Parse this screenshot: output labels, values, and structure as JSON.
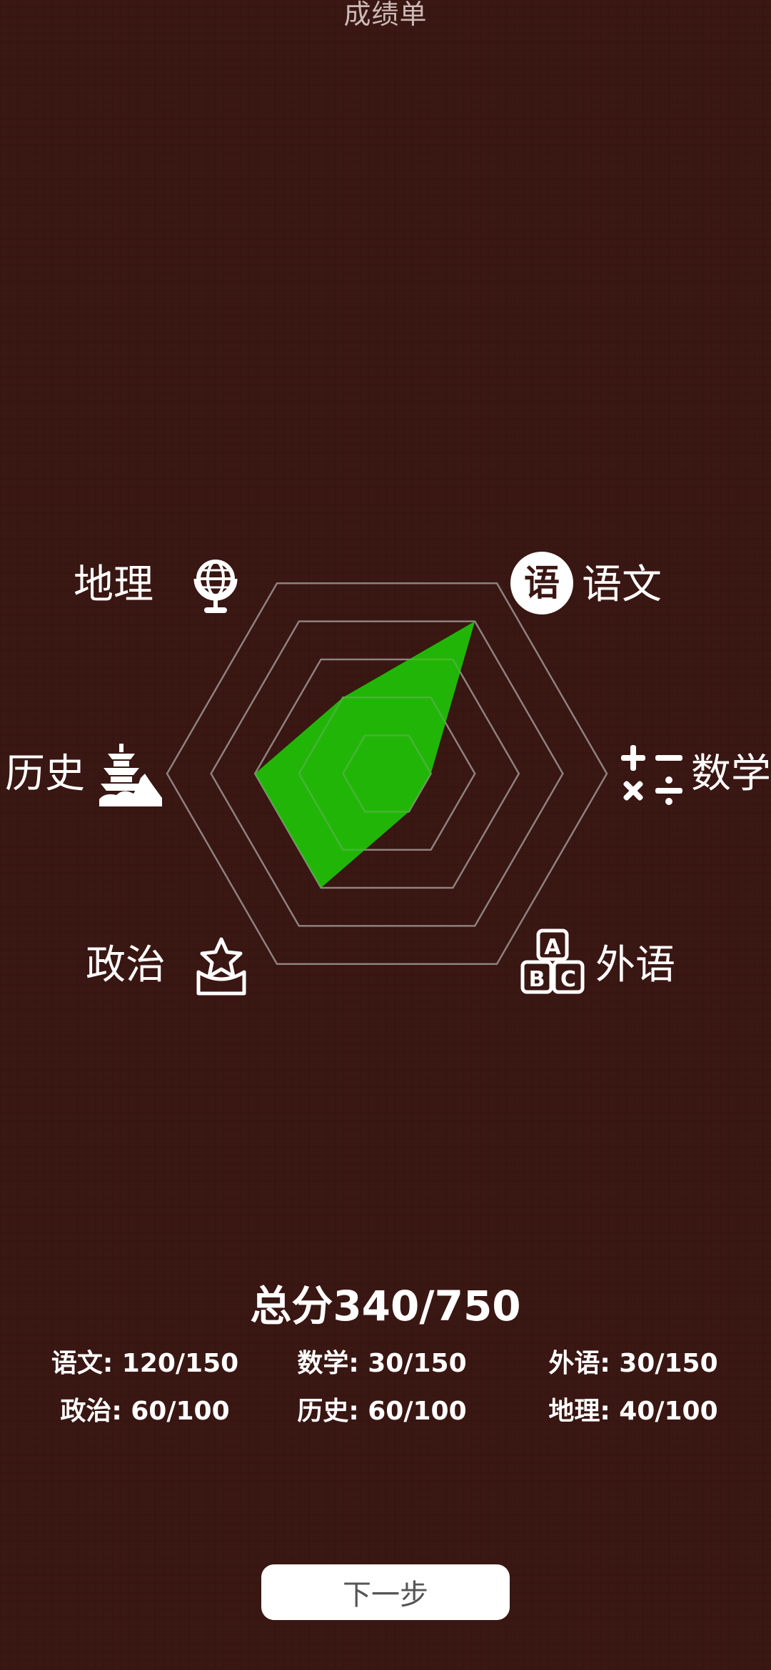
{
  "header": {
    "title": "成绩单"
  },
  "chart_data": {
    "type": "radar",
    "axes": [
      "语文",
      "数学",
      "外语",
      "政治",
      "历史",
      "地理"
    ],
    "max": [
      150,
      150,
      150,
      100,
      100,
      100
    ],
    "values": [
      120,
      30,
      30,
      60,
      60,
      40
    ],
    "rings": 5,
    "fill_color": "#1fc406",
    "grid_color": "#8a7a76"
  },
  "labels": {
    "chinese": "语文",
    "math": "数学",
    "english": "外语",
    "politics": "政治",
    "history": "历史",
    "geography": "地理"
  },
  "icons": {
    "chinese": "yu-character-icon",
    "math": "math-operators-icon",
    "english": "abc-blocks-icon",
    "politics": "star-badge-icon",
    "history": "pagoda-icon",
    "geography": "globe-icon"
  },
  "summary": {
    "total": "总分340/750",
    "scores": [
      "语文: 120/150",
      "数学: 30/150",
      "外语: 30/150",
      "政治: 60/100",
      "历史: 60/100",
      "地理: 40/100"
    ]
  },
  "actions": {
    "next_label": "下一步"
  }
}
